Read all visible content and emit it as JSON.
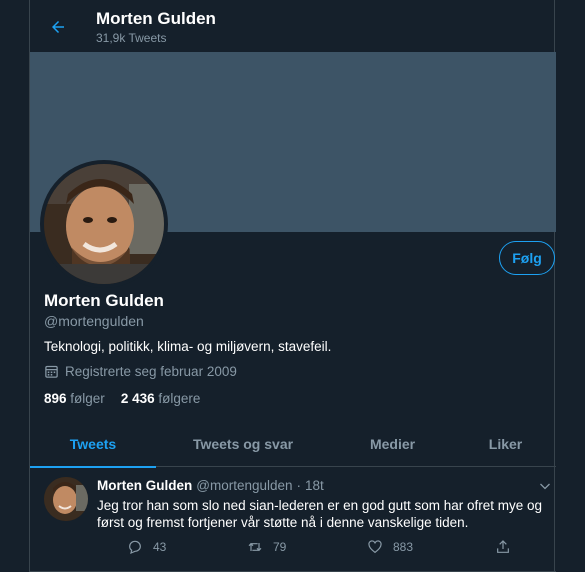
{
  "header": {
    "title": "Morten Gulden",
    "tweet_count": "31,9k Tweets"
  },
  "profile": {
    "name": "Morten Gulden",
    "handle": "@mortengulden",
    "bio": "Teknologi, politikk, klima- og miljøvern, stavefeil.",
    "joined": "Registrerte seg februar 2009",
    "follow_label": "Følg",
    "following_count": "896",
    "following_label": "følger",
    "followers_count": "2 436",
    "followers_label": "følgere"
  },
  "tabs": [
    {
      "label": "Tweets",
      "active": true
    },
    {
      "label": "Tweets og svar",
      "active": false
    },
    {
      "label": "Medier",
      "active": false
    },
    {
      "label": "Liker",
      "active": false
    }
  ],
  "tweet": {
    "name": "Morten Gulden",
    "handle": "@mortengulden",
    "dot": "·",
    "time": "18t",
    "text": "Jeg tror han som slo ned sian-lederen er en god gutt som har ofret mye og først og fremst fortjener vår støtte nå i denne vanskelige tiden.",
    "replies": "43",
    "retweets": "79",
    "likes": "883"
  },
  "colors": {
    "background": "#15202b",
    "accent": "#1da1f2",
    "banner": "#3d5466",
    "secondary_text": "#8899a6",
    "border": "#38444d"
  },
  "icons": [
    "back-arrow-icon",
    "calendar-icon",
    "chevron-down-icon",
    "reply-icon",
    "retweet-icon",
    "like-icon",
    "share-icon"
  ]
}
